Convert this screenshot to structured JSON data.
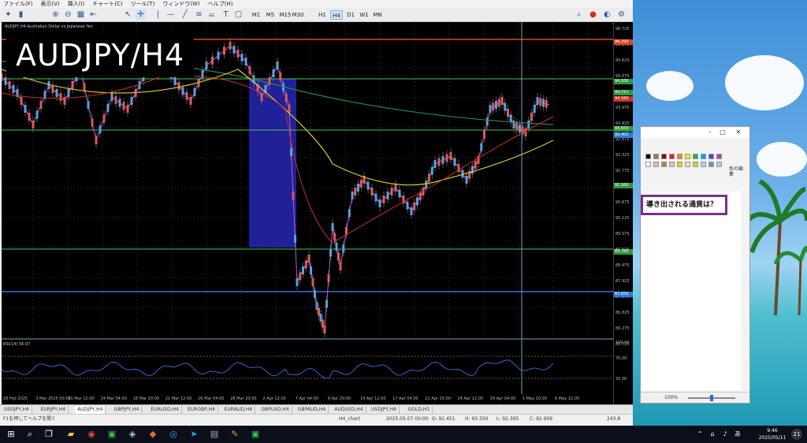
{
  "menu": [
    "ファイル(F)",
    "表示(V)",
    "挿入(I)",
    "チャート(C)",
    "ツール(T)",
    "ウィンドウ(W)",
    "ヘルプ(H)"
  ],
  "timeframes": [
    "M1",
    "M5",
    "M15",
    "M30",
    "H1",
    "H4",
    "D1",
    "W1",
    "MN"
  ],
  "active_timeframe": "H4",
  "chart": {
    "caption": "AUDJPY,H4  Australian Dollar vs Japanese Yen",
    "pair_label": "AUDJPY/H4",
    "rsi_caption": "RSI(14) 56.07"
  },
  "price_axis": [
    "96.725",
    "96.175",
    "95.625",
    "95.075",
    "94.525",
    "93.975",
    "93.425",
    "92.875",
    "92.325",
    "91.775",
    "91.225",
    "90.675",
    "90.125",
    "89.575",
    "89.025",
    "88.475",
    "87.925",
    "87.375",
    "86.825",
    "86.275",
    "85.725"
  ],
  "price_tags": [
    {
      "value": "96.290",
      "color": "#e0451f"
    },
    {
      "value": "94.930",
      "color": "#2f9a3b"
    },
    {
      "value": "94.721",
      "color": "#2f9a3b"
    },
    {
      "value": "94.560",
      "color": "#cc3322"
    },
    {
      "value": "93.650",
      "color": "#2f9a3b"
    },
    {
      "value": "93.402",
      "color": "#2f7ad8"
    },
    {
      "value": "91.560",
      "color": "#2f9a3b"
    },
    {
      "value": "89.780",
      "color": "#2f9a3b"
    },
    {
      "value": "87.650",
      "color": "#2f7ad8"
    }
  ],
  "rsi_axis": [
    "100.00",
    "70.00",
    "30.00"
  ],
  "time_axis": [
    "28 Feb 2025",
    "3 Mar 2025 00:00",
    "11 Mar 12:00",
    "14 Mar 04:00",
    "18 Mar 20:00",
    "21 Mar 12:00",
    "26 Mar 04:00",
    "28 Mar 20:00",
    "2 Apr 12:00",
    "7 Apr 04:00",
    "9 Apr 20:00",
    "14 Apr 12:00",
    "17 Apr 04:00",
    "21 Apr 20:00",
    "24 Apr 12:00",
    "29 Apr 04:00",
    "1 May 20:00",
    "6 May 12:00"
  ],
  "tabs": [
    "USDJPY,H4",
    "EURJPY,H4",
    "AUDJPY,H4",
    "GBPJPY,H4",
    "EURUSD,H4",
    "EURGBP,H4",
    "EURAUD,H4",
    "GBPUSD,H4",
    "GBPAUD,H4",
    "AUDUSD,H4",
    "USDJPY,H4",
    "GOLD,H1"
  ],
  "active_tab": "AUDJPY,H4",
  "status": {
    "help": "F1を押してヘルプを開く",
    "profile": "H4_chart",
    "datetime": "2025.05.07 00:00",
    "open": "O: 92.451",
    "high": "H: 93.330",
    "low": "L: 92.395",
    "close": "C: 92.909",
    "traffic": "243.8"
  },
  "paint": {
    "question": "導き出される通貨は？",
    "color_edit": "色の編集",
    "zoom": "100%",
    "palette_colors": [
      "#000000",
      "#7f7f7f",
      "#880015",
      "#ed1c24",
      "#ff7f27",
      "#fff200",
      "#22b14c",
      "#00a2e8",
      "#3f48cc",
      "#a349a4",
      "#ffffff",
      "#c3c3c3",
      "#b97a57",
      "#ffaec9",
      "#ffc90e",
      "#efe4b0",
      "#b5e61d",
      "#99d9ea",
      "#7092be",
      "#c8bfe7"
    ]
  },
  "taskbar": {
    "time": "9:46",
    "date": "2025/05/11",
    "notification_count": "21"
  }
}
